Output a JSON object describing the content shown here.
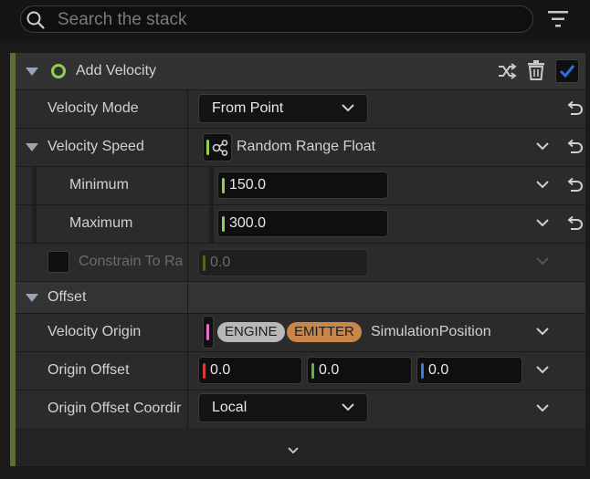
{
  "search": {
    "placeholder": "Search the stack"
  },
  "module": {
    "title": "Add Velocity",
    "enabled": true
  },
  "rows": {
    "velocity_mode": {
      "label": "Velocity Mode",
      "value": "From Point"
    },
    "velocity_speed": {
      "label": "Velocity Speed",
      "value": "Random Range Float"
    },
    "minimum": {
      "label": "Minimum",
      "value": "150.0"
    },
    "maximum": {
      "label": "Maximum",
      "value": "300.0"
    },
    "constrain": {
      "label": "Constrain To Ra",
      "value": "0.0"
    },
    "offset_section": {
      "label": "Offset"
    },
    "velocity_origin": {
      "label": "Velocity Origin",
      "tag_engine": "ENGINE",
      "tag_emitter": "EMITTER",
      "value": "SimulationPosition"
    },
    "origin_offset": {
      "label": "Origin Offset",
      "x": "0.0",
      "y": "0.0",
      "z": "0.0"
    },
    "origin_offset_coord": {
      "label": "Origin Offset Coordir",
      "value": "Local"
    }
  },
  "colors": {
    "accent_green": "#8fd14f",
    "axis_x": "#d23c3c",
    "axis_y": "#5fb53a",
    "axis_z": "#3c7bd8",
    "checkbox_blue": "#2b6fe0",
    "pink": "#e06fd0"
  },
  "icons": {
    "search": "search-icon",
    "filter": "filter-icon",
    "shuffle": "shuffle-icon",
    "delete": "trash-icon",
    "reset": "reset-arrow-icon",
    "chevron": "chevron-down-icon"
  }
}
